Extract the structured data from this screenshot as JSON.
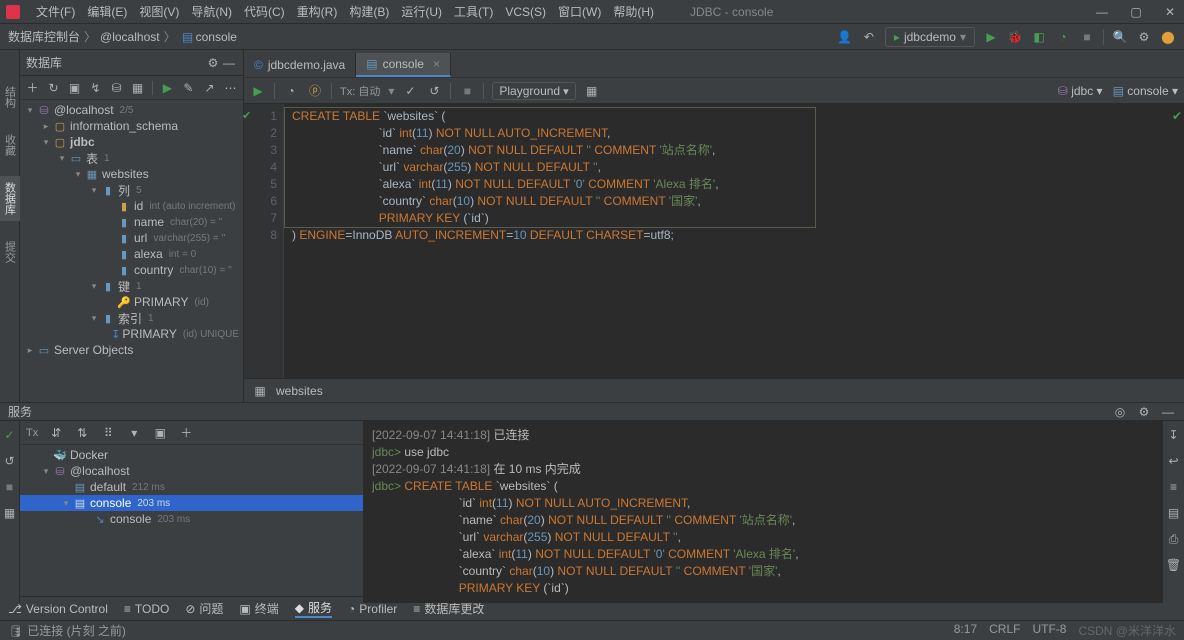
{
  "window": {
    "title": "JDBC - console"
  },
  "menu": [
    "文件(F)",
    "编辑(E)",
    "视图(V)",
    "导航(N)",
    "代码(C)",
    "重构(R)",
    "构建(B)",
    "运行(U)",
    "工具(T)",
    "VCS(S)",
    "窗口(W)",
    "帮助(H)"
  ],
  "breadcrumb": {
    "a": "数据库控制台",
    "b": "@localhost",
    "c": "console"
  },
  "runConfig": "jdbcdemo",
  "database": {
    "title": "数据库",
    "root": {
      "label": "@localhost",
      "meta": "2/5"
    },
    "schemas": [
      {
        "name": "information_schema"
      },
      {
        "name": "jdbc",
        "open": true,
        "tables_label": "表",
        "tables_count": "1",
        "tables": [
          {
            "name": "websites",
            "cols_label": "列",
            "cols_count": "5",
            "cols": [
              {
                "name": "id",
                "meta": "int (auto increment)"
              },
              {
                "name": "name",
                "meta": "char(20) = ''"
              },
              {
                "name": "url",
                "meta": "varchar(255) = ''"
              },
              {
                "name": "alexa",
                "meta": "int = 0"
              },
              {
                "name": "country",
                "meta": "char(10) = ''"
              }
            ],
            "keys_label": "键",
            "keys_count": "1",
            "keys": [
              {
                "name": "PRIMARY",
                "meta": "(id)"
              }
            ],
            "idx_label": "索引",
            "idx_count": "1",
            "idx": [
              {
                "name": "PRIMARY",
                "meta": "(id) UNIQUE"
              }
            ]
          }
        ]
      }
    ],
    "server_objects": "Server Objects"
  },
  "editor": {
    "tabs": [
      {
        "label": "jdbcdemo.java",
        "icon": "java"
      },
      {
        "label": "console",
        "icon": "db",
        "active": true
      }
    ],
    "tx": "Tx: 自动",
    "playground": "Playground",
    "dsn_right": [
      {
        "label": "jdbc"
      },
      {
        "label": "console"
      }
    ],
    "code_lines": [
      "CREATE TABLE `websites` (",
      "                          `id` int(11) NOT NULL AUTO_INCREMENT,",
      "                          `name` char(20) NOT NULL DEFAULT '' COMMENT '站点名称',",
      "                          `url` varchar(255) NOT NULL DEFAULT '',",
      "                          `alexa` int(11) NOT NULL DEFAULT '0' COMMENT 'Alexa 排名',",
      "                          `country` char(10) NOT NULL DEFAULT '' COMMENT '国家',",
      "                          PRIMARY KEY (`id`)",
      ") ENGINE=InnoDB AUTO_INCREMENT=10 DEFAULT CHARSET=utf8;"
    ],
    "result_tab": "websites"
  },
  "services": {
    "title": "服务",
    "tree": {
      "docker": "Docker",
      "localhost": "@localhost",
      "default": {
        "label": "default",
        "meta": "212 ms"
      },
      "console": {
        "label": "console",
        "meta": "203 ms"
      },
      "console2": {
        "label": "console",
        "meta": "203 ms"
      }
    },
    "log": [
      {
        "ts": "[2022-09-07 14:41:18]",
        "txt": " 已连接"
      },
      {
        "prompt": "jdbc> ",
        "cmd": "use jdbc"
      },
      {
        "ts": "[2022-09-07 14:41:18]",
        "txt": " 在 10 ms 内完成"
      },
      {
        "prompt": "jdbc> ",
        "sql": "CREATE TABLE `websites` ("
      },
      {
        "cont": "                          `id` int(11) NOT NULL AUTO_INCREMENT,"
      },
      {
        "cont": "                          `name` char(20) NOT NULL DEFAULT '' COMMENT '站点名称',"
      },
      {
        "cont": "                          `url` varchar(255) NOT NULL DEFAULT '',"
      },
      {
        "cont": "                          `alexa` int(11) NOT NULL DEFAULT '0' COMMENT 'Alexa 排名',"
      },
      {
        "cont": "                          `country` char(10) NOT NULL DEFAULT '' COMMENT '国家',"
      },
      {
        "cont": "                          PRIMARY KEY (`id`)"
      }
    ]
  },
  "toolstrip": [
    {
      "icon": "branch",
      "label": "Version Control"
    },
    {
      "icon": "todo",
      "label": "TODO"
    },
    {
      "icon": "problem",
      "label": "问题"
    },
    {
      "icon": "terminal",
      "label": "终端"
    },
    {
      "icon": "services",
      "label": "服务",
      "active": true
    },
    {
      "icon": "profiler",
      "label": "Profiler"
    },
    {
      "icon": "dbchange",
      "label": "数据库更改"
    }
  ],
  "status": {
    "left": "已连接 (片刻 之前)",
    "pos": "8:17",
    "crlf": "CRLF",
    "enc": "UTF-8",
    "watermark": "CSDN @米洋洋水"
  }
}
